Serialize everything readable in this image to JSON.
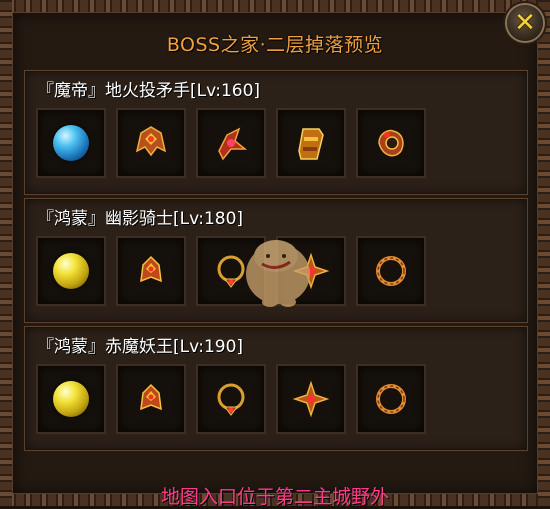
{
  "title": "BOSS之家·二层掉落预览",
  "close_label": "✕",
  "footer_text": "地图入口位于第二主城野外",
  "colors": {
    "title": "#f0a040",
    "footer": "#ff3a8a",
    "close_icon": "#f3d23a"
  },
  "sections": [
    {
      "boss_name": "『魔帝』地火投矛手[Lv:160]",
      "items": [
        {
          "icon": "blue-orb-icon"
        },
        {
          "icon": "helmet-icon"
        },
        {
          "icon": "amulet-icon"
        },
        {
          "icon": "bracer-icon"
        },
        {
          "icon": "ring-icon"
        }
      ]
    },
    {
      "boss_name": "『鸿蒙』幽影骑士[Lv:180]",
      "items": [
        {
          "icon": "yellow-orb-icon"
        },
        {
          "icon": "helmet-icon"
        },
        {
          "icon": "necklace-icon"
        },
        {
          "icon": "amulet-icon"
        },
        {
          "icon": "ring-icon"
        }
      ]
    },
    {
      "boss_name": "『鸿蒙』赤魔妖王[Lv:190]",
      "items": [
        {
          "icon": "yellow-orb-icon"
        },
        {
          "icon": "helmet-icon"
        },
        {
          "icon": "necklace-icon"
        },
        {
          "icon": "amulet-icon"
        },
        {
          "icon": "ring-icon"
        }
      ]
    }
  ]
}
